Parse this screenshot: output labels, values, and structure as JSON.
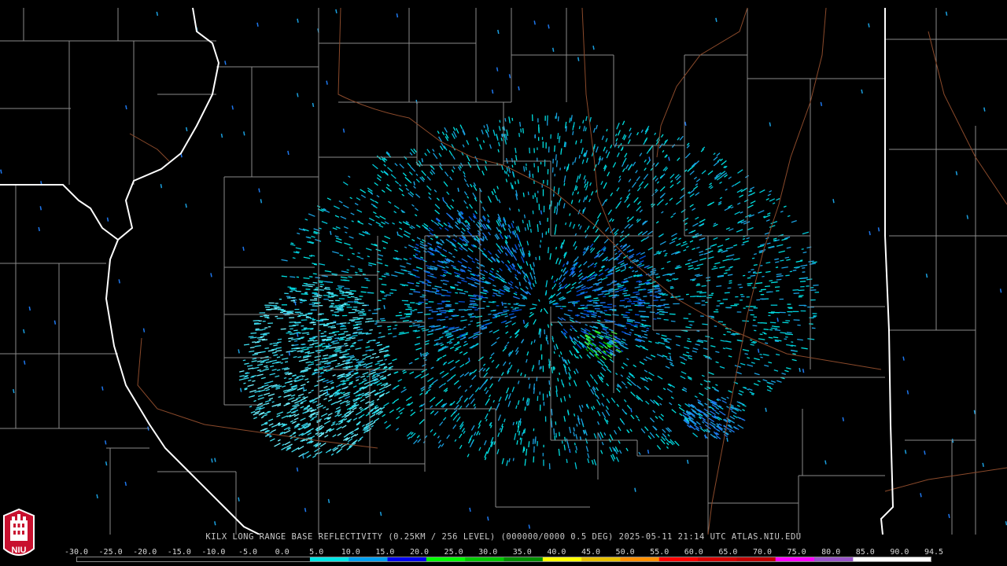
{
  "caption": "KILX LONG RANGE BASE REFLECTIVITY (0.25KM / 256 LEVEL) (000000/0000 0.5 DEG) 2025-05-11 21:14 UTC  ATLAS.NIU.EDU",
  "legend": {
    "ticks": [
      "-30.0",
      "-25.0",
      "-20.0",
      "-15.0",
      "-10.0",
      "-5.0",
      "0.0",
      "5.0",
      "10.0",
      "15.0",
      "20.0",
      "25.0",
      "30.0",
      "35.0",
      "40.0",
      "45.0",
      "50.0",
      "55.0",
      "60.0",
      "65.0",
      "70.0",
      "75.0",
      "80.0",
      "85.0",
      "90.0",
      "94.5"
    ],
    "colors": [
      "#000000",
      "#000000",
      "#000000",
      "#000000",
      "#000000",
      "#000000",
      "#00e6e6",
      "#00a0f0",
      "#0000f0",
      "#00ff00",
      "#00c800",
      "#009000",
      "#ffff00",
      "#e7c000",
      "#ff9000",
      "#ff0000",
      "#d60000",
      "#c00000",
      "#ff00ff",
      "#9955c9",
      "#ffffff",
      "#ffffff"
    ]
  },
  "logo": {
    "text": "NIU",
    "color": "#c8102e"
  }
}
